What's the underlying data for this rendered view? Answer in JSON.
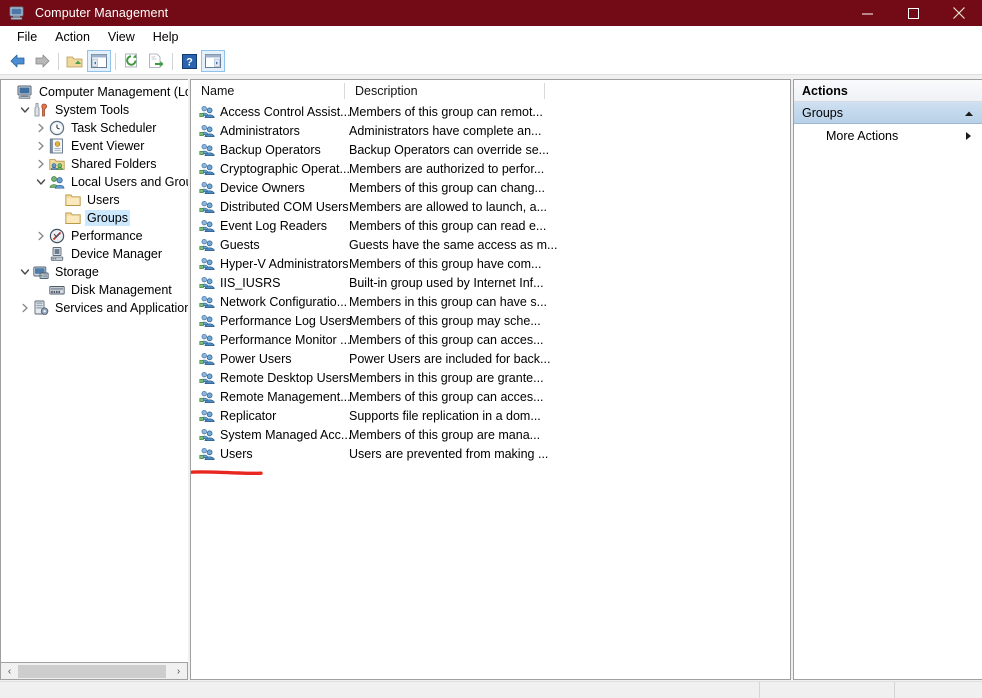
{
  "window": {
    "title": "Computer Management",
    "title_icon": "computer-management-icon",
    "titlebar_color": "#730b16",
    "controls": [
      {
        "name": "minimize",
        "glyph": "minimize-icon"
      },
      {
        "name": "maximize",
        "glyph": "maximize-icon"
      },
      {
        "name": "close",
        "glyph": "close-icon"
      }
    ]
  },
  "menu": {
    "items": [
      {
        "label": "File"
      },
      {
        "label": "Action"
      },
      {
        "label": "View"
      },
      {
        "label": "Help"
      }
    ]
  },
  "toolbar": {
    "buttons": [
      {
        "name": "back-button",
        "icon": "back-arrow-icon",
        "active": false
      },
      {
        "name": "forward-button",
        "icon": "forward-arrow-icon",
        "active": false
      },
      {
        "name": "up-one-level-button",
        "icon": "folder-up-icon",
        "active": false
      },
      {
        "name": "show-hide-console-tree-button",
        "icon": "console-tree-icon",
        "active": true
      },
      {
        "name": "refresh-button",
        "icon": "refresh-icon",
        "active": false
      },
      {
        "name": "export-list-button",
        "icon": "export-list-icon",
        "active": false
      },
      {
        "name": "help-button",
        "icon": "help-question-icon",
        "active": false
      },
      {
        "name": "show-hide-action-pane-button",
        "icon": "action-pane-icon",
        "active": true
      }
    ]
  },
  "tree": {
    "items": [
      {
        "label": "Computer Management (Local",
        "icon": "computer-management-icon",
        "depth": 0,
        "twisty": "none",
        "selected": false
      },
      {
        "label": "System Tools",
        "icon": "system-tools-icon",
        "depth": 1,
        "twisty": "expanded",
        "selected": false
      },
      {
        "label": "Task Scheduler",
        "icon": "clock-icon",
        "depth": 2,
        "twisty": "collapsed",
        "selected": false
      },
      {
        "label": "Event Viewer",
        "icon": "event-viewer-icon",
        "depth": 2,
        "twisty": "collapsed",
        "selected": false
      },
      {
        "label": "Shared Folders",
        "icon": "shared-folders-icon",
        "depth": 2,
        "twisty": "collapsed",
        "selected": false
      },
      {
        "label": "Local Users and Groups",
        "icon": "local-users-groups-icon",
        "depth": 2,
        "twisty": "expanded",
        "selected": false
      },
      {
        "label": "Users",
        "icon": "folder-icon",
        "depth": 3,
        "twisty": "none",
        "selected": false
      },
      {
        "label": "Groups",
        "icon": "folder-icon",
        "depth": 3,
        "twisty": "none",
        "selected": true
      },
      {
        "label": "Performance",
        "icon": "performance-icon",
        "depth": 2,
        "twisty": "collapsed",
        "selected": false
      },
      {
        "label": "Device Manager",
        "icon": "device-manager-icon",
        "depth": 2,
        "twisty": "none",
        "selected": false
      },
      {
        "label": "Storage",
        "icon": "storage-icon",
        "depth": 1,
        "twisty": "expanded",
        "selected": false
      },
      {
        "label": "Disk Management",
        "icon": "disk-management-icon",
        "depth": 2,
        "twisty": "none",
        "selected": false
      },
      {
        "label": "Services and Applications",
        "icon": "services-applications-icon",
        "depth": 1,
        "twisty": "collapsed",
        "selected": false
      }
    ],
    "hscrollbar": {
      "left_arrow": "‹",
      "right_arrow": "›"
    }
  },
  "list": {
    "columns": [
      {
        "label": "Name"
      },
      {
        "label": "Description"
      }
    ],
    "rows": [
      {
        "name": "Access Control Assist...",
        "description": "Members of this group can remot...",
        "icon": "group-icon"
      },
      {
        "name": "Administrators",
        "description": "Administrators have complete an...",
        "icon": "group-icon"
      },
      {
        "name": "Backup Operators",
        "description": "Backup Operators can override se...",
        "icon": "group-icon"
      },
      {
        "name": "Cryptographic Operat...",
        "description": "Members are authorized to perfor...",
        "icon": "group-icon"
      },
      {
        "name": "Device Owners",
        "description": "Members of this group can chang...",
        "icon": "group-icon"
      },
      {
        "name": "Distributed COM Users",
        "description": "Members are allowed to launch, a...",
        "icon": "group-icon"
      },
      {
        "name": "Event Log Readers",
        "description": "Members of this group can read e...",
        "icon": "group-icon"
      },
      {
        "name": "Guests",
        "description": "Guests have the same access as m...",
        "icon": "group-icon"
      },
      {
        "name": "Hyper-V Administrators",
        "description": "Members of this group have com...",
        "icon": "group-icon"
      },
      {
        "name": "IIS_IUSRS",
        "description": "Built-in group used by Internet Inf...",
        "icon": "group-icon"
      },
      {
        "name": "Network Configuratio...",
        "description": "Members in this group can have s...",
        "icon": "group-icon"
      },
      {
        "name": "Performance Log Users",
        "description": "Members of this group may sche...",
        "icon": "group-icon"
      },
      {
        "name": "Performance Monitor ...",
        "description": "Members of this group can acces...",
        "icon": "group-icon"
      },
      {
        "name": "Power Users",
        "description": "Power Users are included for back...",
        "icon": "group-icon"
      },
      {
        "name": "Remote Desktop Users",
        "description": "Members in this group are grante...",
        "icon": "group-icon"
      },
      {
        "name": "Remote Management...",
        "description": "Members of this group can acces...",
        "icon": "group-icon"
      },
      {
        "name": "Replicator",
        "description": "Supports file replication in a dom...",
        "icon": "group-icon"
      },
      {
        "name": "System Managed Acc...",
        "description": "Members of this group are mana...",
        "icon": "group-icon"
      },
      {
        "name": "Users",
        "description": "Users are prevented from making ...",
        "icon": "group-icon"
      }
    ]
  },
  "annotation": {
    "name": "red-underline-annotation",
    "color": "#e8281e"
  },
  "actions": {
    "title": "Actions",
    "group_label": "Groups",
    "group_collapse_icon": "chevron-up-icon",
    "items": [
      {
        "label": "More Actions",
        "submenu_icon": "triangle-right-icon"
      }
    ]
  },
  "statusbar": {
    "text": ""
  }
}
